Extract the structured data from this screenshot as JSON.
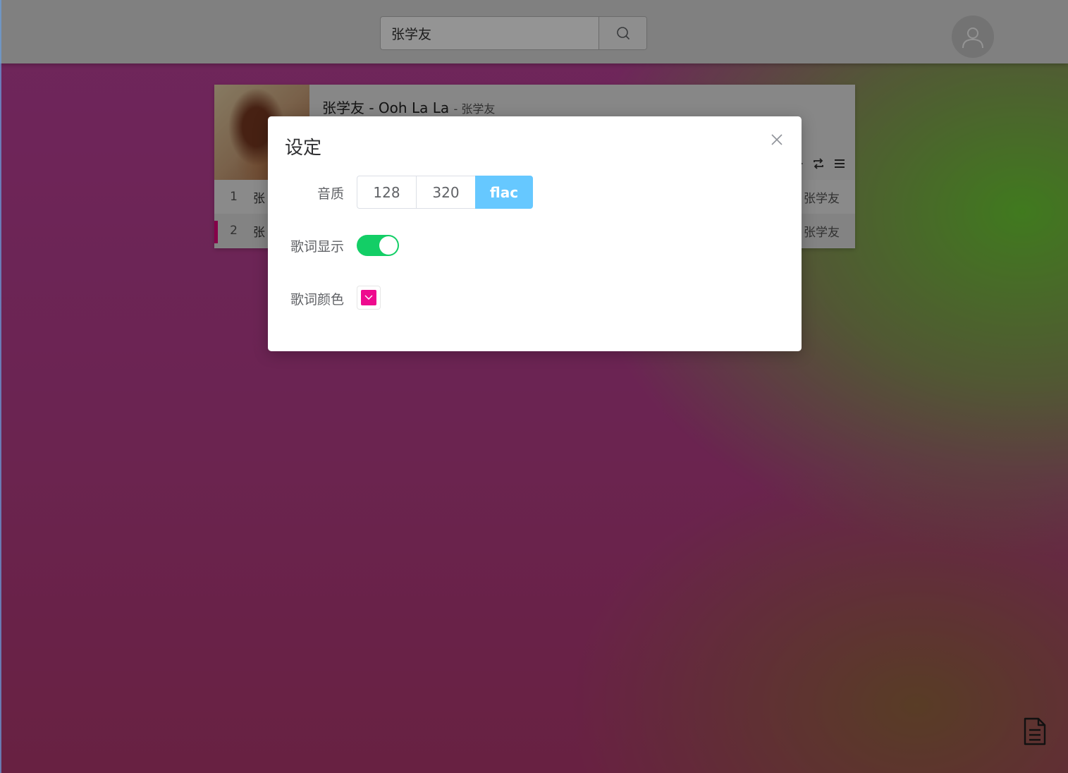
{
  "search": {
    "value": "张学友",
    "icon": "search-icon"
  },
  "header": {
    "avatar_icon": "user-icon"
  },
  "player": {
    "now_playing": {
      "title": "张学友 - Ooh La La",
      "artist": "- 张学友"
    },
    "playlist": [
      {
        "index": "1",
        "name": "张",
        "artist": "张学友"
      },
      {
        "index": "2",
        "name": "张",
        "artist": "张学友"
      }
    ],
    "active_color": "#e6007e"
  },
  "dialog": {
    "title": "设定",
    "quality_label": "音质",
    "quality_options": [
      "128",
      "320",
      "flac"
    ],
    "quality_selected": "flac",
    "lyric_display_label": "歌词显示",
    "lyric_display_on": true,
    "lyric_color_label": "歌词颜色",
    "lyric_color": "#ee0a8e",
    "accent_color": "#66c8ff",
    "switch_color": "#13ce66"
  },
  "fab": {
    "icon": "document-icon"
  }
}
